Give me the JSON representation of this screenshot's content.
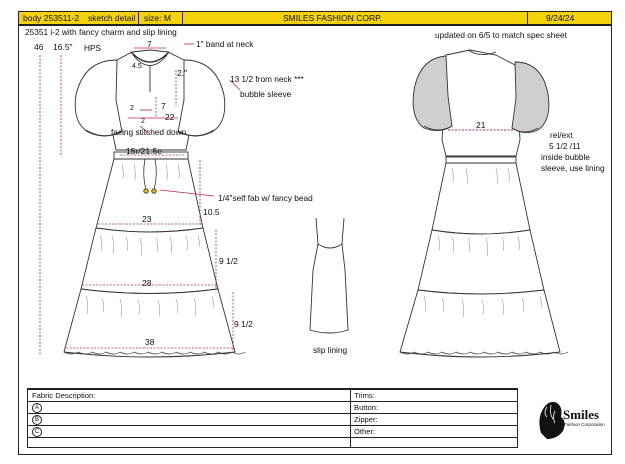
{
  "header": {
    "body": "body 253511-2",
    "view": "sketch detail",
    "size": "size: M",
    "company": "SMILES FASHION CORP.",
    "date": "9/24/24"
  },
  "notes": {
    "style_desc": "25351 i-2 with fancy charm and slip lining",
    "updated": "updated on 6/5 to match spec sheet",
    "band": "1\" band at neck",
    "from_neck": "13 1/2  from neck  ***",
    "bubble": "bubble sleeve",
    "facing": "facing stitched down",
    "fab": "1/4\"self fab w/ fancy bead",
    "slip": "slip lining",
    "relext": "rel/ext",
    "relext_val": "5 1/2 /11",
    "inside1": "inside bubble",
    "inside2": "sleeve, use lining",
    "hps": "HPS"
  },
  "measures": {
    "m46": "46",
    "m165": "16.5\"",
    "m7_top": "7",
    "m45": "4.5",
    "m2_slit": "2.\"",
    "m2_a": "2",
    "m2_b": "2",
    "m7_side": "7",
    "m22": "22",
    "m1515": "15r/21.5e",
    "m105": "10.5",
    "m23": "23",
    "m912_a": "9 1/2",
    "m28": "28",
    "m912_b": "9 1/2",
    "m38": "38",
    "m21": "21"
  },
  "form": {
    "fabric": "Fabric Description:",
    "a": "A",
    "b": "B",
    "c": "C",
    "trims": "Trims:",
    "button": "Button:",
    "zipper": "Zipper:",
    "other": "Other:"
  },
  "logo": {
    "name": "Smiles",
    "sub": "Fashion Corporation"
  },
  "colors": {
    "header_bg": "#f4d20a",
    "measure_line": "#c0245c",
    "sleeve_back": "#cfcfcf"
  }
}
